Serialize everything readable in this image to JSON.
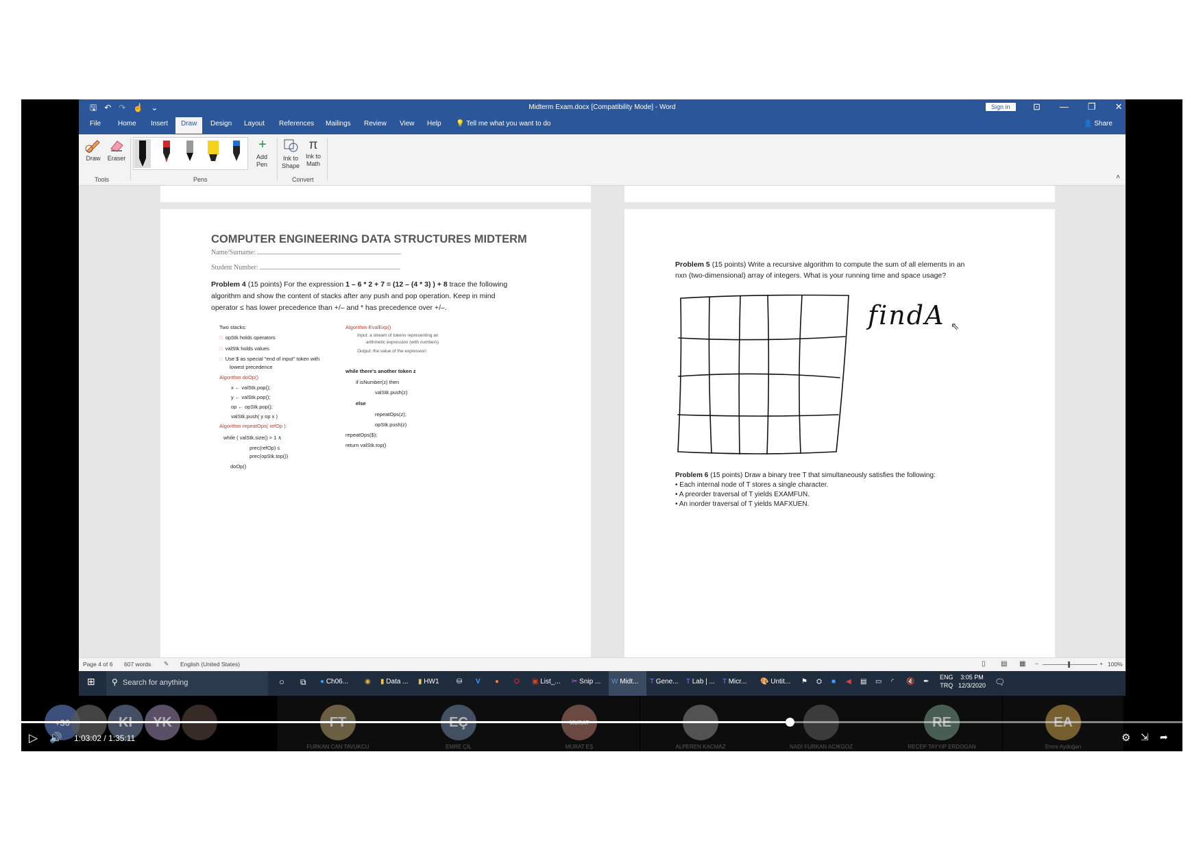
{
  "word": {
    "qat_icons": [
      "save-icon",
      "undo-icon",
      "redo-icon",
      "touch-mode-icon",
      "customize-icon"
    ],
    "doc_title": "Midterm Exam.docx [Compatibility Mode]  -  Word",
    "sign_in": "Sign in",
    "window_controls": [
      "⊡",
      "—",
      "❐",
      "✕"
    ],
    "menu_tabs": [
      "File",
      "Home",
      "Insert",
      "Draw",
      "Design",
      "Layout",
      "References",
      "Mailings",
      "Review",
      "View",
      "Help"
    ],
    "active_tab": "Draw",
    "tell_me": "Tell me what you want to do",
    "share": "Share",
    "ribbon": {
      "draw": "Draw",
      "eraser": "Eraser",
      "tools_group": "Tools",
      "pens_group": "Pens",
      "pen_colors": [
        "#111111",
        "#d0272d",
        "#111111",
        "#f2d21b",
        "#1e6fd0"
      ],
      "add_pen": "Add Pen",
      "ink_to_shape": "Ink to Shape",
      "ink_to_math": "Ink to Math",
      "convert_group": "Convert"
    },
    "status": {
      "page": "Page 4 of 6",
      "words": "607 words",
      "language": "English (United States)",
      "zoom": "100%"
    }
  },
  "page_left": {
    "title": "COMPUTER ENGINEERING DATA STRUCTURES MIDTERM",
    "name_label": "Name/Surname:",
    "student_label": "Student Number:",
    "p4_label": "Problem 4",
    "p4_text1": "(15 points) For the expression",
    "p4_expr": "1 – 6 * 2 + 7 = (12 – (4 * 3) ) + 8",
    "p4_text2": "trace the following",
    "p4_line2": "algorithm and show the content of stacks after any push and pop operation. Keep in mind",
    "p4_line3": "operator ≤ has lower precedence than +/– and * has precedence over +/–.",
    "algo_left": [
      "Two stacks:",
      "opStk holds operators",
      "valStk holds values",
      "Use $ as special \"end of input\" token with",
      "lowest precedence",
      "Algorithm doOp()",
      "x ← valStk.pop();",
      "y ← valStk.pop();",
      "op ← opStk.pop();",
      "valStk.push( y op x )",
      "Algorithm repeatOps( refOp ):",
      "while ( valStk.size() > 1 ∧",
      "prec(refOp) ≤",
      "prec(opStk.top())",
      "doOp()"
    ],
    "algo_right": [
      "Algorithm EvalExp()",
      "Input: a stream of tokens representing an",
      "arithmetic expression (with numbers)",
      "Output: the value of the expression",
      "while there's another token z",
      "if isNumber(z) then",
      "valStk.push(z)",
      "else",
      "repeatOps(z);",
      "opStk.push(z)",
      "repeatOps($);",
      "return valStk.top()"
    ]
  },
  "page_right": {
    "p5_label": "Problem 5",
    "p5_line1": "(15 points) Write a recursive algorithm to compute the sum of all elements in an",
    "p5_line2": "nxn (two-dimensional) array of integers. What is your running time and space usage?",
    "handwriting": "findA",
    "p6_label": "Problem 6",
    "p6_line1": "(15 points) Draw a binary tree T that simultaneously satisfies the following:",
    "p6_bullets": [
      "• Each internal node of T stores a single character.",
      "• A preorder traversal of T yields EXAMFUN.",
      "• An inorder traversal of T yields MAFXUEN."
    ]
  },
  "taskbar": {
    "search_placeholder": "Search for anything",
    "apps": [
      "Ch06...",
      "Data ...",
      "HW1",
      "List_...",
      "Snip ...",
      "Midt...",
      "Gene...",
      "Lab | ...",
      "Micr...",
      "Untit..."
    ],
    "lang1": "ENG",
    "lang2": "TRQ",
    "time": "3:05 PM",
    "date": "12/3/2020"
  },
  "meeting": {
    "overflow": "+36",
    "participants": [
      {
        "initials": "",
        "name": "",
        "color": "#5a5a5a"
      },
      {
        "initials": "KI",
        "name": "",
        "color": "#5b6a85"
      },
      {
        "initials": "YK",
        "name": "",
        "color": "#7a6a8a"
      },
      {
        "initials": "",
        "name": "",
        "color": "#4a3a35"
      },
      {
        "initials": "FT",
        "name": "FURKAN CAN TAVUKCU",
        "color": "#8a7a55"
      },
      {
        "initials": "EÇ",
        "name": "EMRE ÇİL",
        "color": "#56677f"
      },
      {
        "initials": "MURAT",
        "name": "MURAT EŞ",
        "color": "#8a5e55"
      },
      {
        "initials": "",
        "name": "ALPEREN KACMAZ",
        "color": "#6a6a6a"
      },
      {
        "initials": "",
        "name": "NADI FURKAN ACIKGOZ",
        "color": "#4b4b4b"
      },
      {
        "initials": "RE",
        "name": "RECEP TAYYIP ERDOGAN",
        "color": "#5e7a6a"
      },
      {
        "initials": "EA",
        "name": "Emre Aydoğan",
        "color": "#9a7a3a"
      }
    ]
  },
  "video": {
    "current_time": "1:03:02",
    "duration": "1:35:11",
    "progress": 0.662
  }
}
